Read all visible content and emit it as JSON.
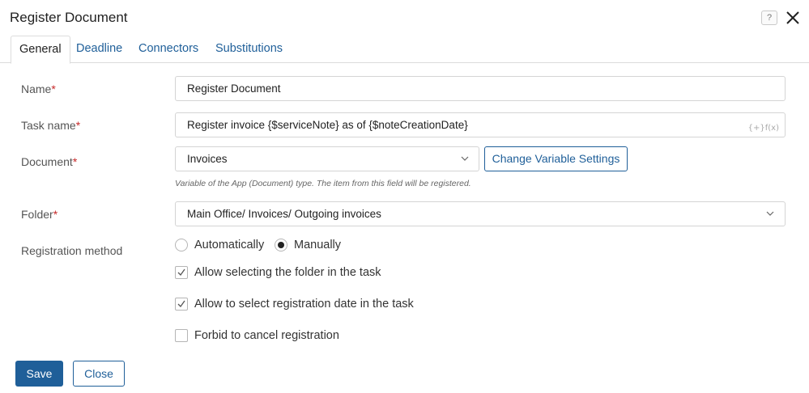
{
  "dialog": {
    "title": "Register Document",
    "help_label": "?"
  },
  "tabs": [
    {
      "label": "General",
      "active": true
    },
    {
      "label": "Deadline",
      "active": false
    },
    {
      "label": "Connectors",
      "active": false
    },
    {
      "label": "Substitutions",
      "active": false
    }
  ],
  "form": {
    "required_marker": "*",
    "name": {
      "label": "Name",
      "value": "Register Document"
    },
    "task_name": {
      "label": "Task name",
      "value": "Register invoice {$serviceNote} as of {$noteCreationDate}",
      "fx_label": "{+}f(x)"
    },
    "document": {
      "label": "Document",
      "value": "Invoices",
      "settings_button": "Change Variable Settings",
      "hint": "Variable of the App (Document) type. The item from this field will be registered."
    },
    "folder": {
      "label": "Folder",
      "value": "Main Office/ Invoices/ Outgoing invoices"
    },
    "registration_method": {
      "label": "Registration method",
      "options": [
        {
          "label": "Automatically",
          "selected": false
        },
        {
          "label": "Manually",
          "selected": true
        }
      ]
    },
    "checkboxes": [
      {
        "label": "Allow selecting the folder in the task",
        "checked": true
      },
      {
        "label": "Allow to select registration date in the task",
        "checked": true
      },
      {
        "label": "Forbid to cancel registration",
        "checked": false
      }
    ]
  },
  "footer": {
    "save_label": "Save",
    "close_label": "Close"
  },
  "colors": {
    "accent": "#1f5f99",
    "required": "#c62828",
    "border": "#d4d4d4"
  }
}
